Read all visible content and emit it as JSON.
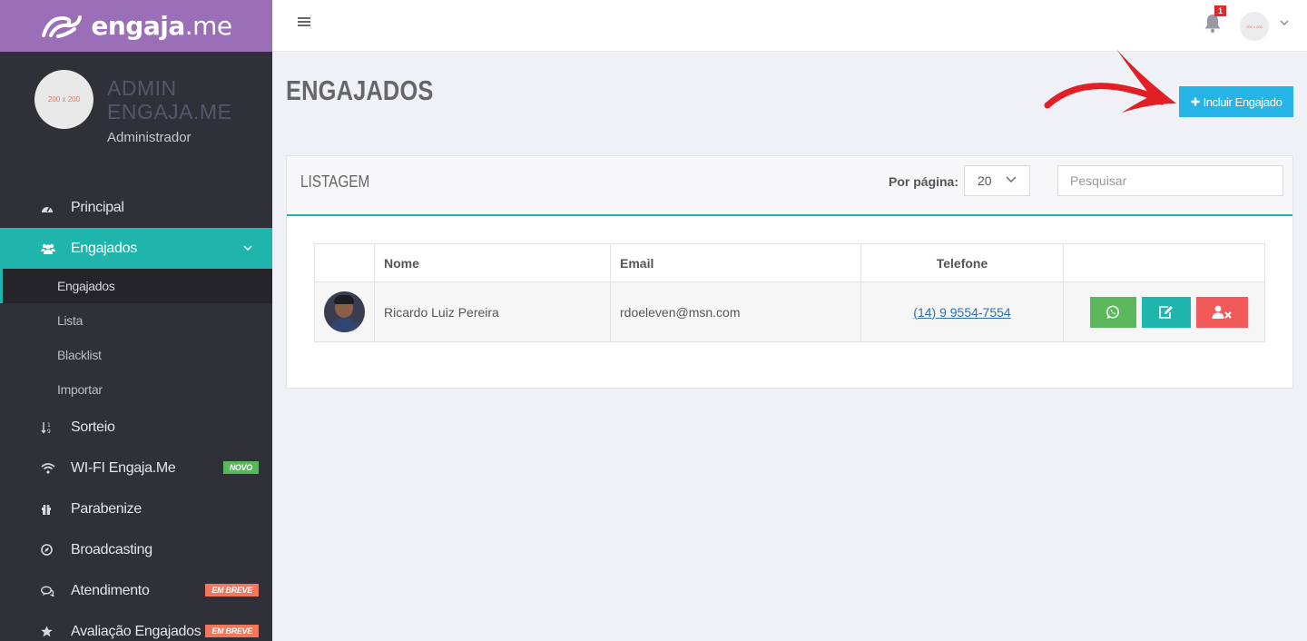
{
  "brand": {
    "prefix": "engaja",
    "suffix": ".me"
  },
  "profile": {
    "avatar_placeholder": "200 x 200",
    "name_line1": "ADMIN",
    "name_line2": "ENGAJA.ME",
    "role": "Administrador"
  },
  "menu": {
    "items": [
      {
        "label": "Principal",
        "icon": "dashboard-icon"
      },
      {
        "label": "Engajados",
        "icon": "users-icon"
      },
      {
        "label": "Sorteio",
        "icon": "sort-numeric-icon"
      },
      {
        "label": "WI-FI Engaja.Me",
        "icon": "wifi-icon",
        "badge": "NOVO"
      },
      {
        "label": "Parabenize",
        "icon": "gift-icon"
      },
      {
        "label": "Broadcasting",
        "icon": "compass-icon"
      },
      {
        "label": "Atendimento",
        "icon": "chat-icon",
        "badge": "EM BREVE"
      },
      {
        "label": "Avaliação Engajados",
        "icon": "star-icon",
        "badge": "EM BREVE"
      }
    ],
    "submenu": [
      "Engajados",
      "Lista",
      "Blacklist",
      "Importar"
    ]
  },
  "topbar": {
    "notification_count": "1",
    "user_avatar_placeholder": "200 x 200"
  },
  "page": {
    "title": "ENGAJADOS",
    "add_button": "Incluir Engajado"
  },
  "listing": {
    "title": "LISTAGEM",
    "per_page_label": "Por página:",
    "per_page_value": "20",
    "search_placeholder": "Pesquisar",
    "columns": [
      "",
      "Nome",
      "Email",
      "Telefone",
      ""
    ],
    "rows": [
      {
        "name": "Ricardo Luiz Pereira",
        "email": "rdoeleven@msn.com",
        "phone": "(14) 9 9554-7554"
      }
    ]
  },
  "colors": {
    "brand_purple": "#9a6fb8",
    "sidebar_bg": "#2f3038",
    "accent_teal": "#1fb5ac",
    "primary_blue": "#26b4e6",
    "whatsapp_green": "#5cb85c",
    "danger_red": "#f25a5a",
    "annotation_arrow_red": "#e01f26"
  }
}
